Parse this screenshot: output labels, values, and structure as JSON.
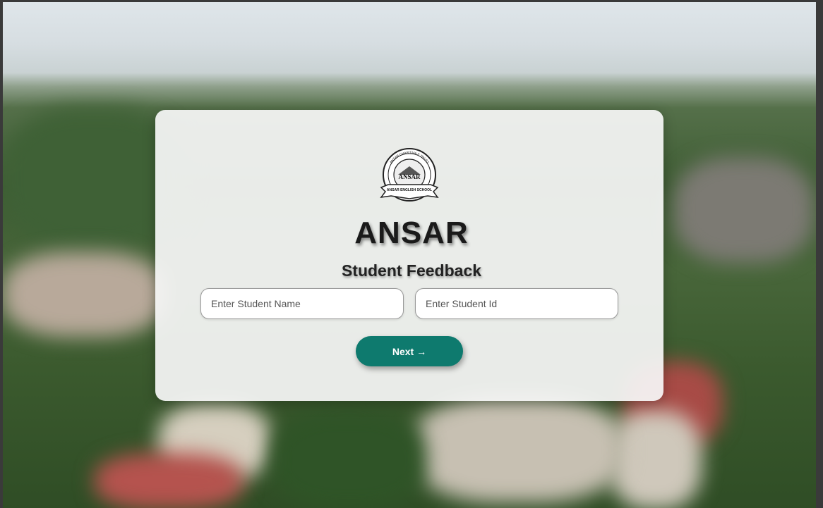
{
  "brand": {
    "logo_icon": "ansar-school-seal-icon",
    "logo_top_text": "ANSAR CHARITABLE TRUST",
    "logo_center_text": "ANSAR",
    "logo_ribbon_text": "ANSAR ENGLISH SCHOOL",
    "title": "ANSAR"
  },
  "form": {
    "heading": "Student Feedback",
    "student_name_placeholder": "Enter Student Name",
    "student_name_value": "",
    "student_id_placeholder": "Enter Student Id",
    "student_id_value": "",
    "next_label": "Next →"
  },
  "colors": {
    "accent": "#0e7a6e",
    "card_bg": "#f6f6f6",
    "title": "#1a1a1a"
  }
}
